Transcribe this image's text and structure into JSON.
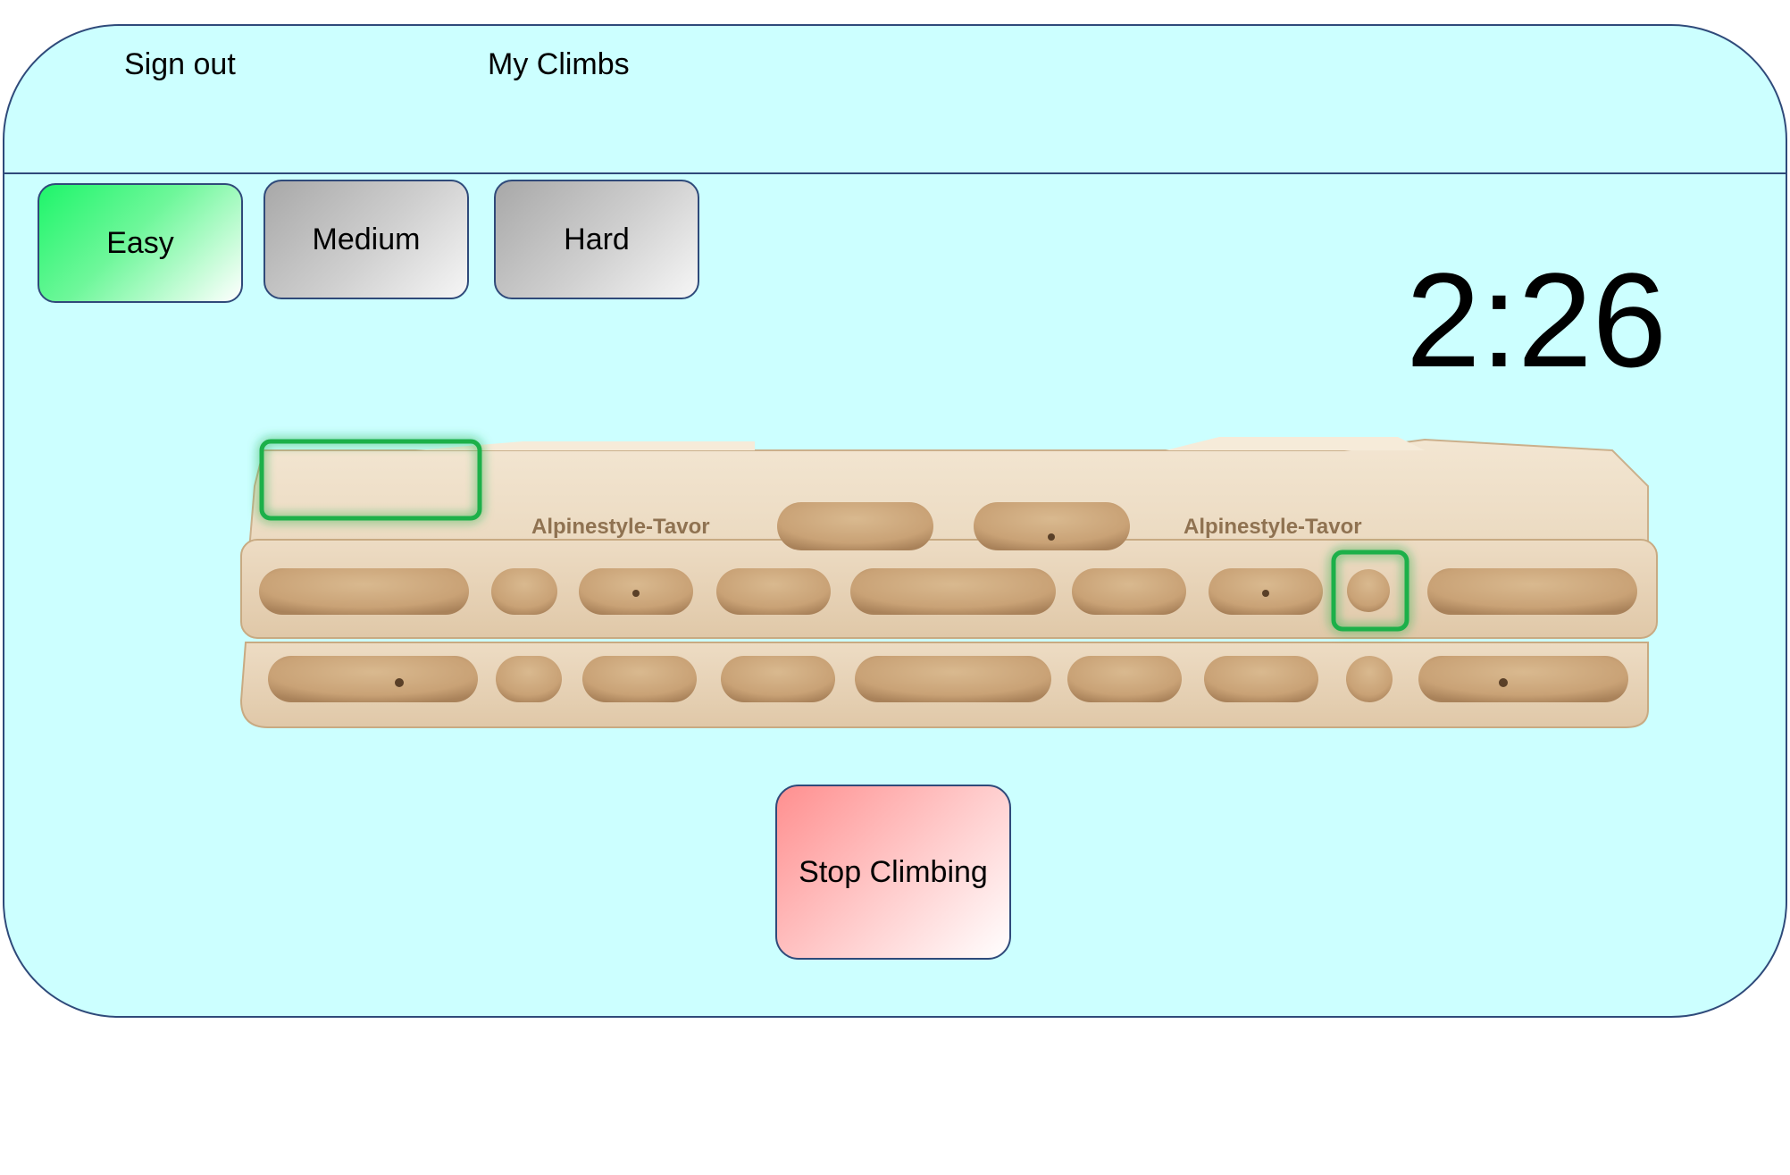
{
  "header": {
    "sign_out": "Sign out",
    "my_climbs": "My Climbs"
  },
  "levels": {
    "easy": "Easy",
    "medium": "Medium",
    "hard": "Hard",
    "selected": "Easy"
  },
  "timer": "2:26",
  "board": {
    "brand": "Alpinestyle-Tavor"
  },
  "actions": {
    "stop": "Stop Climbing"
  },
  "colors": {
    "background": "#ccffff",
    "highlight": "#22b04a",
    "stop": "#ff9a9a",
    "easy": "#1ef56a"
  }
}
